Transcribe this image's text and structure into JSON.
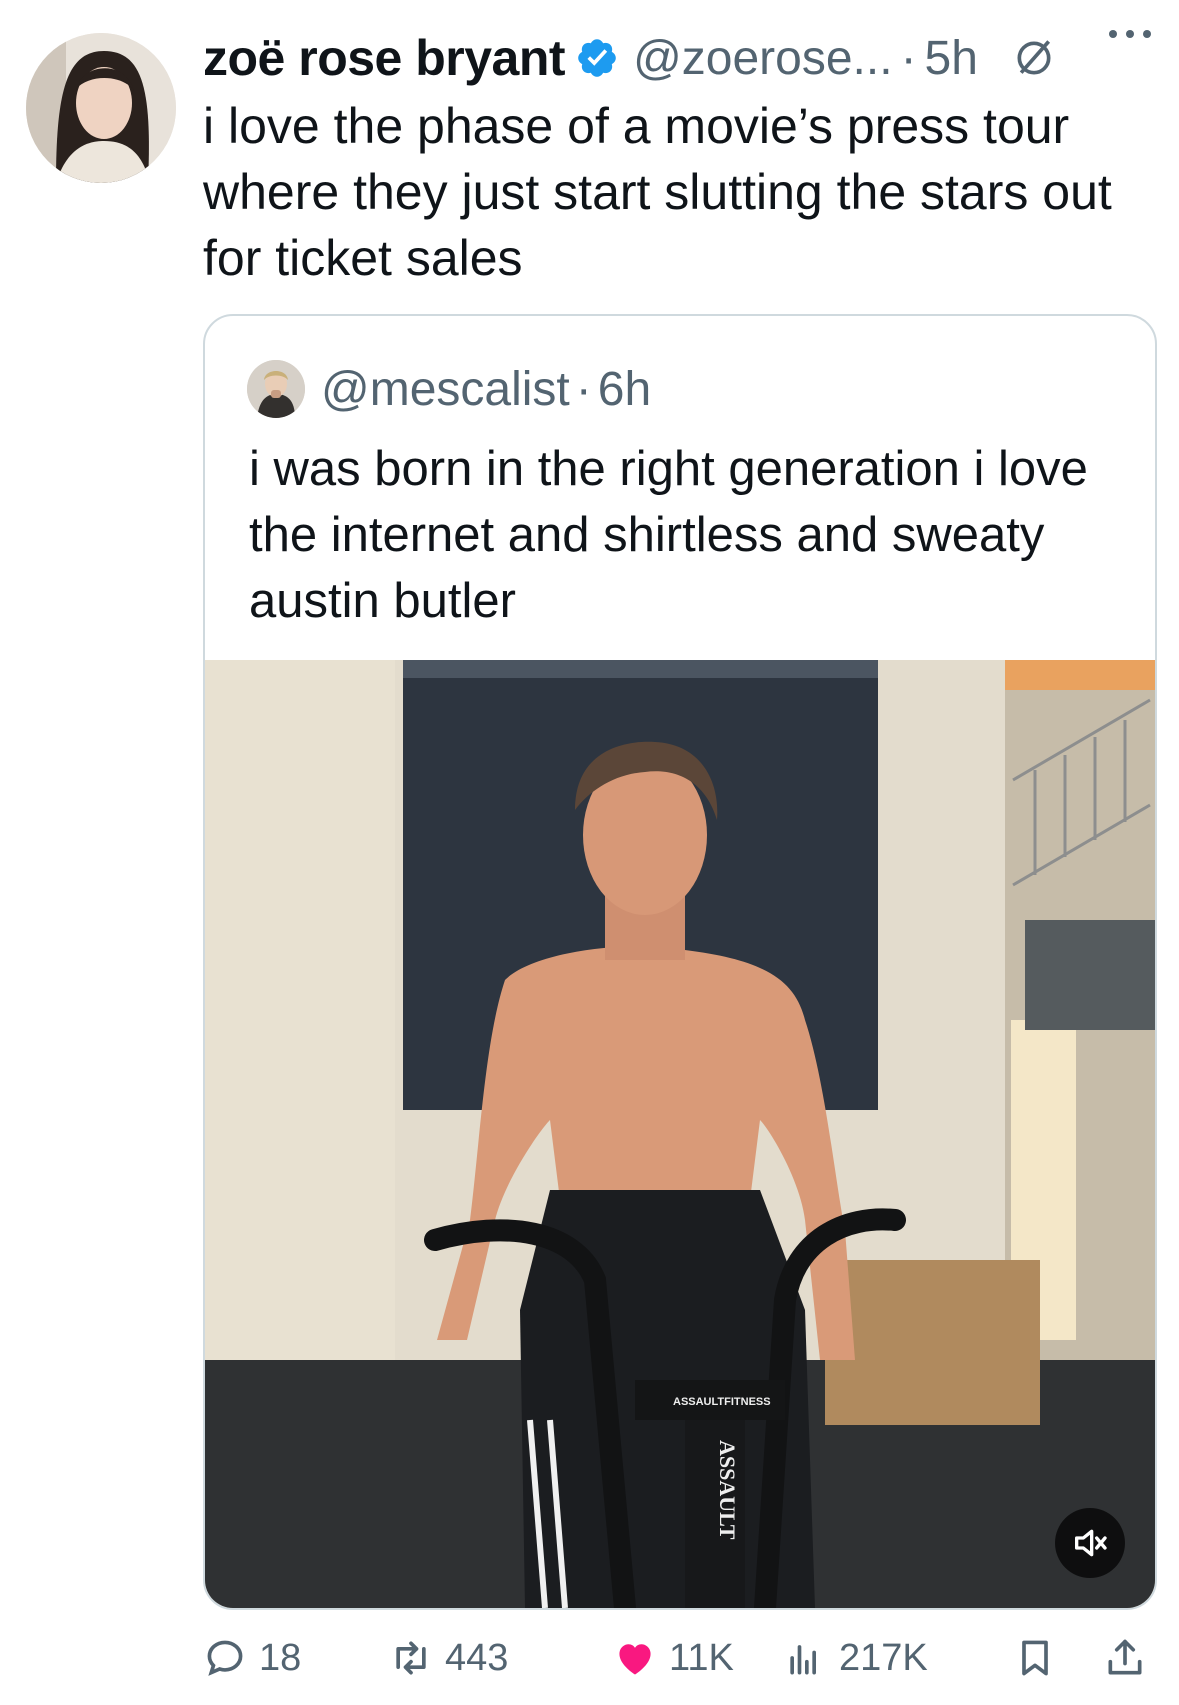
{
  "tweet": {
    "display_name": "zoë rose bryant",
    "handle": "@zoerose...",
    "separator": "·",
    "time": "5h",
    "text": "i love the phase of a movie’s press tour where they just start slutting the stars out for ticket sales"
  },
  "quoted": {
    "handle": "@mescalist",
    "separator": "·",
    "time": "6h",
    "text": "i was born in the right generation i love the internet and shirtless and sweaty austin butler",
    "media_brand_text": "ASSAULTFITNESS",
    "media_bike_text": "ASSAULT"
  },
  "actions": {
    "replies": "18",
    "reposts": "443",
    "likes": "11K",
    "views": "217K"
  },
  "colors": {
    "verified": "#1d9bf0",
    "like": "#f91880",
    "secondary_text": "#536471",
    "border": "#cfd9de"
  },
  "icons": [
    "verified-badge-icon",
    "muted-circle-icon",
    "more-icon",
    "reply-icon",
    "repost-icon",
    "like-icon",
    "views-icon",
    "bookmark-icon",
    "share-icon",
    "mute-icon"
  ]
}
